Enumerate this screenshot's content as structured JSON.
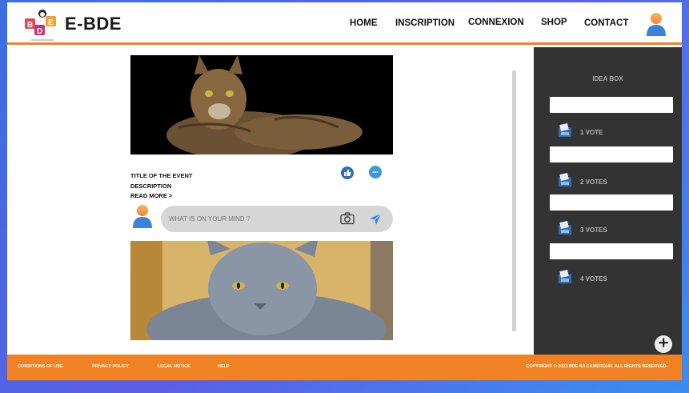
{
  "brand": {
    "name": "E-BDE",
    "logo_letters": [
      "B",
      "D",
      "E"
    ]
  },
  "nav": {
    "items": [
      {
        "label": "HOME"
      },
      {
        "label": "INSCRIPTION"
      },
      {
        "label": "CONNEXION"
      },
      {
        "label": "SHOP"
      },
      {
        "label": "CONTACT"
      }
    ]
  },
  "post": {
    "title": "TITLE OF THE EVENT",
    "description": "DESCRIPTION",
    "read_more": "READ MORE >"
  },
  "comment": {
    "placeholder": "WHAT IS ON YOUR MIND ?"
  },
  "idea_box": {
    "title": "IDEA BOX",
    "votes": [
      {
        "label": "1 VOTE"
      },
      {
        "label": "2 VOTES"
      },
      {
        "label": "3 VOTES"
      },
      {
        "label": "4 VOTES"
      }
    ]
  },
  "footer": {
    "links": [
      "CONDITIONS OF USE",
      "PRIVACY POLICY",
      "LEGAL NOTICE",
      "HELP"
    ],
    "copyright": "COPYRIGHT © 2023 BDE IUI CAMEROUN. ALL RIGHTS RESERVED."
  },
  "colors": {
    "accent": "#f08224",
    "sidebar": "#333333",
    "like": "#2f6fb5",
    "chat": "#3a9ad9",
    "send": "#2d8ae0"
  }
}
